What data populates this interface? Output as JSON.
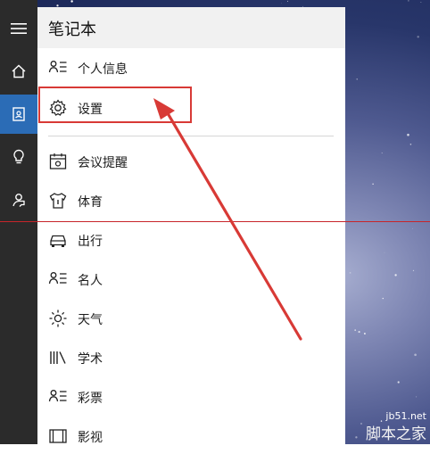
{
  "panel": {
    "title": "笔记本"
  },
  "menu": {
    "items": [
      {
        "label": "个人信息",
        "icon": "profile-list-icon"
      },
      {
        "label": "设置",
        "icon": "gear-icon"
      },
      {
        "label": "会议提醒",
        "icon": "calendar-icon"
      },
      {
        "label": "体育",
        "icon": "jersey-icon"
      },
      {
        "label": "出行",
        "icon": "car-icon"
      },
      {
        "label": "名人",
        "icon": "profile-list-icon"
      },
      {
        "label": "天气",
        "icon": "sun-icon"
      },
      {
        "label": "学术",
        "icon": "books-icon"
      },
      {
        "label": "彩票",
        "icon": "profile-list-icon"
      },
      {
        "label": "影视",
        "icon": "film-icon"
      }
    ]
  },
  "sidebar": {
    "items": [
      {
        "icon": "hamburger-menu-icon"
      },
      {
        "icon": "home-icon"
      },
      {
        "icon": "notebook-icon",
        "active": true
      },
      {
        "icon": "lightbulb-icon"
      },
      {
        "icon": "feedback-icon"
      }
    ]
  },
  "watermark": {
    "url": "jb51.net",
    "text": "脚本之家"
  },
  "colors": {
    "accent": "#2b6cb6",
    "annotation_red": "#d83a36",
    "rail": "#2b2b2b"
  }
}
